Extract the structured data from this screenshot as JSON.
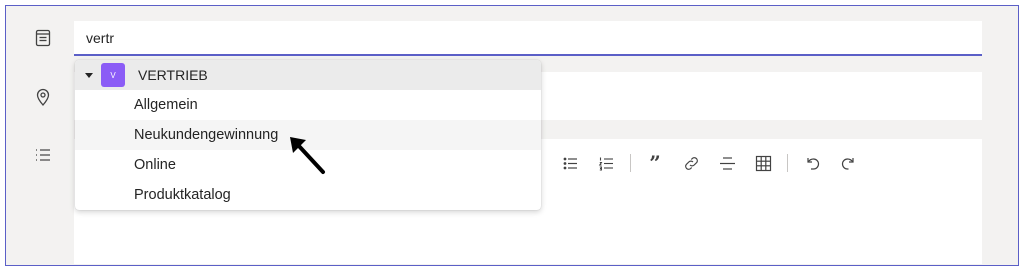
{
  "title_input": {
    "value": "vertr"
  },
  "dropdown": {
    "group": {
      "badge": "V",
      "label": "VERTRIEB"
    },
    "items": [
      {
        "label": "Allgemein"
      },
      {
        "label": "Neukundengewinnung"
      },
      {
        "label": "Online"
      },
      {
        "label": "Produktkatalog"
      }
    ]
  },
  "toolbar": {
    "quote_glyph": "”",
    "buttons": [
      "strikethrough-icon",
      "bulleted-list-icon",
      "numbered-list-icon",
      "quote-icon",
      "link-icon",
      "horizontal-rule-icon",
      "table-icon",
      "undo-icon",
      "redo-icon"
    ]
  },
  "colors": {
    "accent": "#5b5fc7",
    "badge": "#8b5cf6",
    "hover_row": "#f5f5f5",
    "group_row": "#ebebeb"
  }
}
